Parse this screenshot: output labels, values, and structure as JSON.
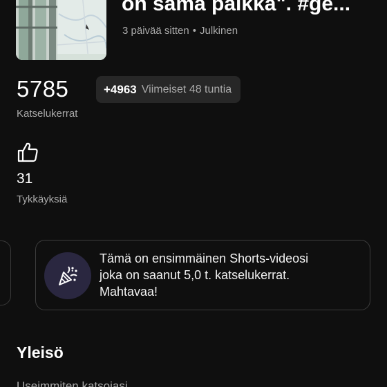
{
  "video": {
    "title": "on sama paikka\". #ge...",
    "age": "3 päivää sitten",
    "separator": "•",
    "visibility": "Julkinen"
  },
  "views": {
    "count": "5785",
    "delta": "+4963",
    "delta_period": "Viimeiset 48 tuntia",
    "label": "Katselukerrat"
  },
  "likes": {
    "count": "31",
    "label": "Tykkäyksiä",
    "icon": "thumbs-up-icon"
  },
  "milestone": {
    "icon": "party-popper-icon",
    "lines": [
      "Tämä on ensimmäinen Shorts-videosi",
      "joka on saanut 5,0 t. katselukerrat.",
      "Mahtavaa!"
    ]
  },
  "audience": {
    "title": "Yleisö",
    "subtitle": "Useimmiten katsojasi"
  },
  "colors": {
    "background": "#0f0f0f",
    "secondary_text": "#aaaaaa",
    "chip": "#272727",
    "milestone_circle": "#2a2740"
  }
}
